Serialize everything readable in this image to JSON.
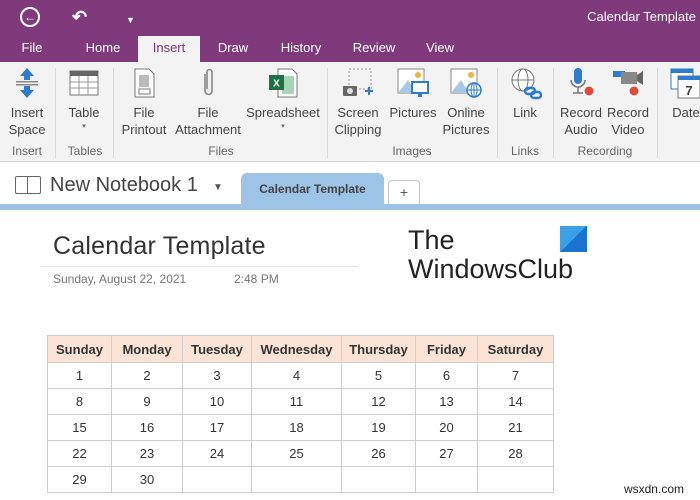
{
  "window": {
    "title": "Calendar Template",
    "quick_access": {
      "back_icon": "back-arrow-icon",
      "undo_icon": "undo-icon",
      "customize_icon": "customize-qat-icon"
    }
  },
  "ribbon_tabs": [
    {
      "label": "File"
    },
    {
      "label": "Home"
    },
    {
      "label": "Insert",
      "active": true
    },
    {
      "label": "Draw"
    },
    {
      "label": "History"
    },
    {
      "label": "Review"
    },
    {
      "label": "View"
    }
  ],
  "ribbon": {
    "buttons": [
      {
        "line1": "Insert",
        "line2": "Space",
        "icon": "insert-space-icon"
      },
      {
        "line1": "Table",
        "line2": "▾",
        "icon": "table-icon"
      },
      {
        "line1": "File",
        "line2": "Printout",
        "icon": "file-printout-icon"
      },
      {
        "line1": "File",
        "line2": "Attachment",
        "icon": "paperclip-icon"
      },
      {
        "line1": "Spreadsheet",
        "line2": "▾",
        "icon": "excel-icon"
      },
      {
        "line1": "Screen",
        "line2": "Clipping",
        "icon": "screen-clipping-icon"
      },
      {
        "line1": "Pictures",
        "line2": "",
        "icon": "pictures-icon"
      },
      {
        "line1": "Online",
        "line2": "Pictures",
        "icon": "online-pictures-icon"
      },
      {
        "line1": "Link",
        "line2": "",
        "icon": "link-icon"
      },
      {
        "line1": "Record",
        "line2": "Audio",
        "icon": "microphone-icon"
      },
      {
        "line1": "Record",
        "line2": "Video",
        "icon": "video-camera-icon"
      },
      {
        "line1": "Date",
        "line2": "",
        "icon": "calendar-date-icon",
        "date_number": "7"
      }
    ],
    "groups": [
      "Insert",
      "Tables",
      "Files",
      "Images",
      "Links",
      "Recording"
    ]
  },
  "notebook": {
    "name": "New Notebook 1",
    "section_tab": "Calendar Template",
    "add_tab_label": "+"
  },
  "page": {
    "title": "Calendar Template",
    "date": "Sunday, August 22, 2021",
    "time": "2:48 PM",
    "brand_line1": "The",
    "brand_line2": "WindowsClub"
  },
  "calendar": {
    "headers": [
      "Sunday",
      "Monday",
      "Tuesday",
      "Wednesday",
      "Thursday",
      "Friday",
      "Saturday"
    ],
    "rows": [
      [
        "1",
        "2",
        "3",
        "4",
        "5",
        "6",
        "7"
      ],
      [
        "8",
        "9",
        "10",
        "11",
        "12",
        "13",
        "14"
      ],
      [
        "15",
        "16",
        "17",
        "18",
        "19",
        "20",
        "21"
      ],
      [
        "22",
        "23",
        "24",
        "25",
        "26",
        "27",
        "28"
      ],
      [
        "29",
        "30",
        "",
        "",
        "",
        "",
        ""
      ]
    ],
    "header_color": "#fbe4d5"
  },
  "colors": {
    "brand_purple": "#80397b",
    "section_blue": "#9dc3e6"
  },
  "watermark": "wsxdn.com"
}
